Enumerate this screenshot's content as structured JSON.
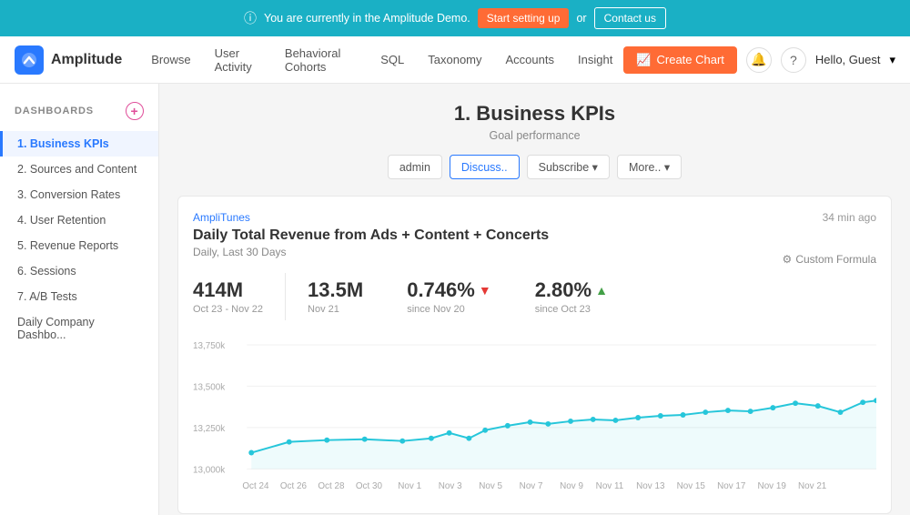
{
  "banner": {
    "message": "You are currently in the Amplitude Demo.",
    "btn_setup": "Start setting up",
    "or_text": "or",
    "btn_contact": "Contact us"
  },
  "nav": {
    "logo_text": "Amplitude",
    "links": [
      "Browse",
      "User Activity",
      "Behavioral Cohorts",
      "SQL",
      "Taxonomy",
      "Accounts",
      "Insight"
    ],
    "btn_create": "Create Chart",
    "hello": "Hello, Guest"
  },
  "sidebar": {
    "header": "DASHBOARDS",
    "items": [
      {
        "label": "1. Business KPIs",
        "active": true
      },
      {
        "label": "2. Sources and Content",
        "active": false
      },
      {
        "label": "3. Conversion Rates",
        "active": false
      },
      {
        "label": "4. User Retention",
        "active": false
      },
      {
        "label": "5. Revenue Reports",
        "active": false
      },
      {
        "label": "6. Sessions",
        "active": false
      },
      {
        "label": "7. A/B Tests",
        "active": false
      },
      {
        "label": "Daily Company Dashbo...",
        "active": false
      }
    ]
  },
  "page": {
    "title": "1. Business KPIs",
    "subtitle": "Goal performance",
    "actions": [
      "admin",
      "Discuss..",
      "Subscribe ▾",
      "More.. ▾"
    ]
  },
  "chart": {
    "source": "AmpliTunes",
    "time_ago": "34 min ago",
    "title": "Daily Total Revenue from Ads + Content + Concerts",
    "period": "Daily, Last 30 Days",
    "custom_formula": "Custom Formula",
    "stats": [
      {
        "value": "414M",
        "label": "Oct 23 - Nov 22",
        "arrow": ""
      },
      {
        "value": "13.5M",
        "label": "Nov 21",
        "arrow": ""
      },
      {
        "value": "0.746%",
        "label": "since Nov 20",
        "arrow": "down"
      },
      {
        "value": "2.80%",
        "label": "since Oct 23",
        "arrow": "up"
      }
    ],
    "y_labels": [
      "13,750k",
      "13,500k",
      "13,250k",
      "13,000k"
    ],
    "x_labels": [
      "Oct 24",
      "Oct 26",
      "Oct 28",
      "Oct 30",
      "Nov 1",
      "Nov 3",
      "Nov 5",
      "Nov 7",
      "Nov 9",
      "Nov 11",
      "Nov 13",
      "Nov 15",
      "Nov 17",
      "Nov 19",
      "Nov 21"
    ]
  }
}
